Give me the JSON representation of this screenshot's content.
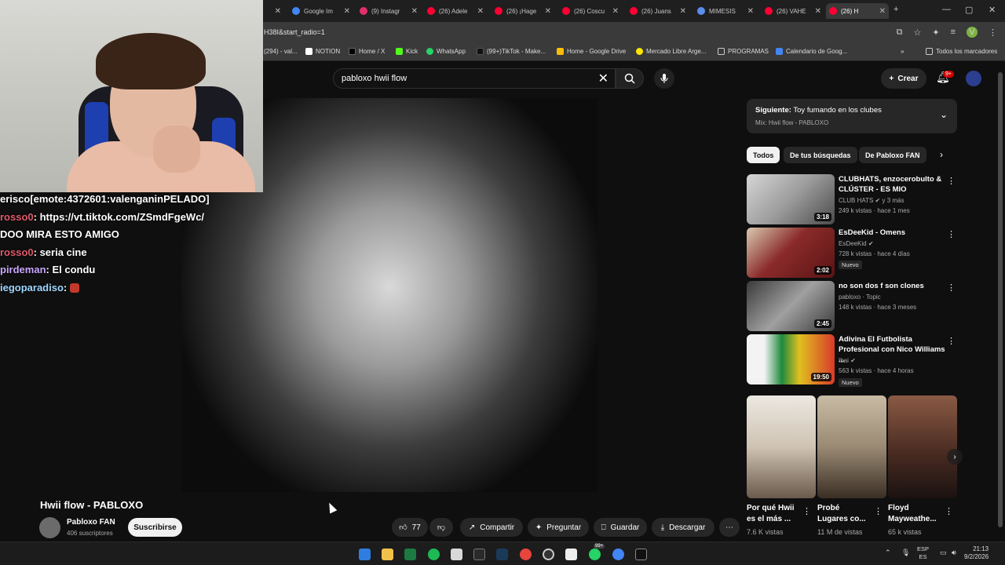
{
  "browser": {
    "tabs": [
      {
        "label": "",
        "color": "#888888"
      },
      {
        "label": "Google Im",
        "color": "#4285f4"
      },
      {
        "label": "(9) Instagr",
        "color": "#e1306c"
      },
      {
        "label": "(26) Adele",
        "color": "#ff0033"
      },
      {
        "label": "(26) ¡Hage",
        "color": "#ff0033"
      },
      {
        "label": "(26) Coscu",
        "color": "#ff0033"
      },
      {
        "label": "(26) Juans",
        "color": "#ff0033"
      },
      {
        "label": "MIMESIS",
        "color": "#5b8def"
      },
      {
        "label": "(26) VAHE",
        "color": "#ff0033"
      },
      {
        "label": "(26) H",
        "color": "#ff0033"
      }
    ],
    "url": "H38I&start_radio=1",
    "profile_initial": "V",
    "bookmarks": [
      {
        "label": "(294) - val...",
        "color": "#9147ff"
      },
      {
        "label": "NOTION",
        "color": "#ffffff"
      },
      {
        "label": "Home / X",
        "color": "#000000"
      },
      {
        "label": "Kick",
        "color": "#53fc18"
      },
      {
        "label": "WhatsApp",
        "color": "#25d366"
      },
      {
        "label": "(99+)TikTok - Make...",
        "color": "#111111"
      },
      {
        "label": "Home - Google Drive",
        "color": "#fbbc04"
      },
      {
        "label": "Mercado Libre Arge...",
        "color": "#ffe600"
      },
      {
        "label": "PROGRAMAS",
        "color": "#bdbdbd"
      },
      {
        "label": "Calendario de Goog...",
        "color": "#4285f4"
      }
    ],
    "all_bookmarks": "Todos los marcadores"
  },
  "youtube": {
    "search_query": "pabloxo hwii flow",
    "create_label": "Crear",
    "notif_count": "9+"
  },
  "chat": [
    {
      "user": "erisco",
      "text": "[emote:4372601:valenganinPELADO]"
    },
    {
      "user": "rosso0",
      "text": ": https://vt.tiktok.com/ZSmdFgeWc/"
    },
    {
      "user": "",
      "text": "DOO MIRA ESTO AMIGO"
    },
    {
      "user": "rosso0",
      "text": ":  seria cine"
    },
    {
      "user": "pirdeman",
      "text": ":  El condu"
    },
    {
      "user": "iegoparadiso",
      "text": ": "
    }
  ],
  "video": {
    "title": "Hwii flow - PABLOXO",
    "channel": "Pabloxo FAN",
    "subscribers": "406 suscriptores",
    "subscribe_label": "Suscribirse",
    "likes": "77",
    "share_label": "Compartir",
    "ask_label": "Preguntar",
    "save_label": "Guardar",
    "download_label": "Descargar"
  },
  "up_next": {
    "title_prefix": "Siguiente:",
    "title": "Toy fumando en los clubes",
    "sub": "Mix: Hwii flow - PABLOXO"
  },
  "chips": [
    "Todos",
    "De tus búsquedas",
    "De Pabloxo FAN"
  ],
  "recommendations": [
    {
      "title": "CLUBHATS, enzocerobulto & CLÚSTER - ES MIO",
      "channel": "CLUB HATS",
      "meta": "249 k vistas · hace 1 mes",
      "duration": "3:18",
      "badge": "",
      "verified_note": "y 3 más",
      "colors": [
        "#c9c9c9",
        "#6c6c6c"
      ]
    },
    {
      "title": "EsDeeKid - Omens",
      "channel": "EsDeeKid",
      "meta": "728 k vistas · hace 4 días",
      "duration": "2:02",
      "badge": "Nuevo",
      "verified_note": "",
      "colors": [
        "#7a1c1c",
        "#d9c9b0"
      ]
    },
    {
      "title": "no son dos f son clones",
      "channel": "pabloxo · Topic",
      "meta": "148 k vistas · hace 3 meses",
      "duration": "2:45",
      "badge": "",
      "verified_note": "",
      "colors": [
        "#3a3a3a",
        "#bfbfbf"
      ]
    },
    {
      "title": "Adivina El Futbolista Profesional con Nico Williams ...",
      "channel": "Ibai",
      "meta": "563 k vistas · hace 4 horas",
      "duration": "19:50",
      "badge": "Nuevo",
      "verified_note": "",
      "colors": [
        "#1e8a3c",
        "#d83a2a"
      ]
    }
  ],
  "shorts": [
    {
      "title": "Por qué Hwii es el más ...",
      "views": "7.6 K vistas",
      "colors": [
        "#e7e2da",
        "#8a7a6c"
      ]
    },
    {
      "title": "Probé Lugares co...",
      "views": "11 M de vistas",
      "colors": [
        "#b8a990",
        "#5a4c3c"
      ]
    },
    {
      "title": "Floyd Mayweathe...",
      "views": "65 k vistas",
      "colors": [
        "#6a4030",
        "#2a1c18"
      ]
    }
  ],
  "taskbar": {
    "lang_top": "ESP",
    "lang_bottom": "ES",
    "time": "21:13",
    "date": "9/2/2026",
    "badge": "99+"
  }
}
